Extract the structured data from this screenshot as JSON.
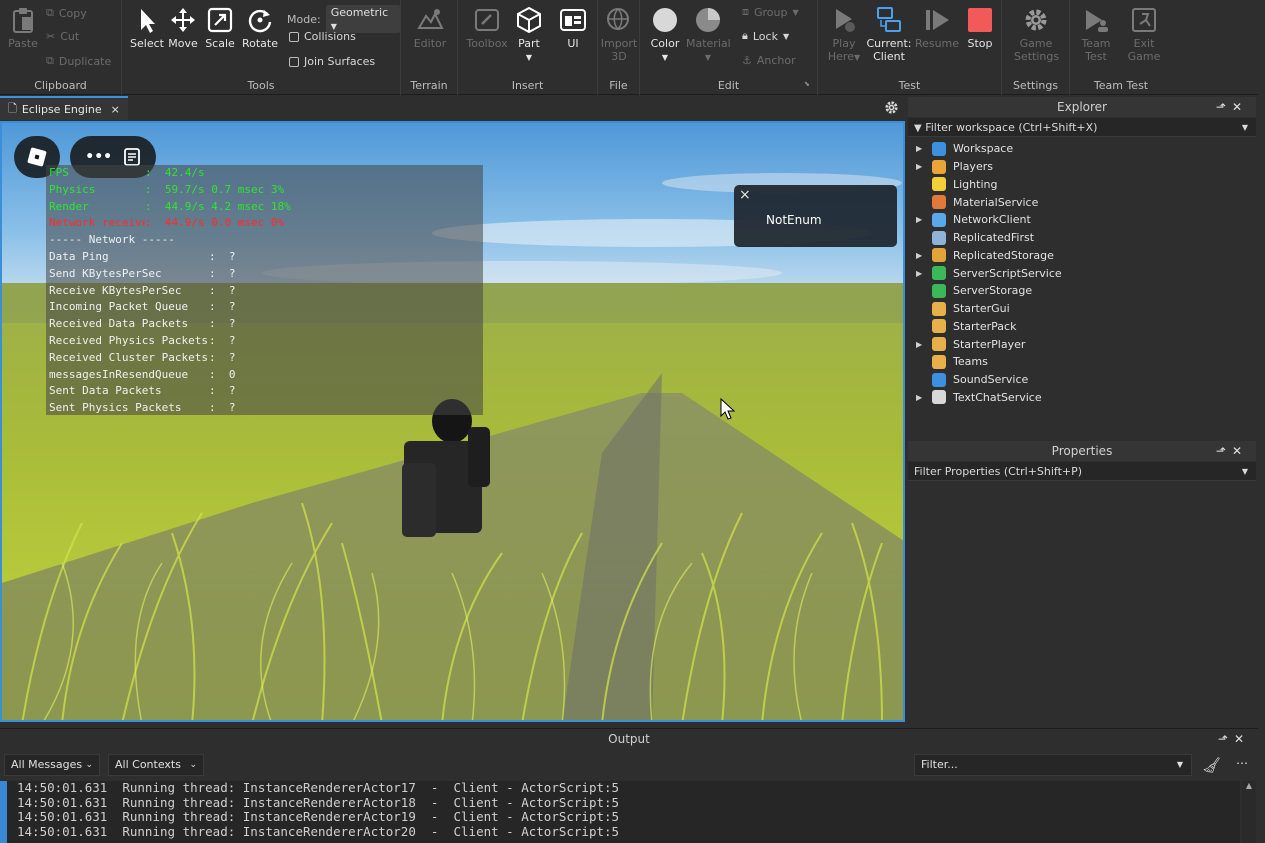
{
  "ribbon": {
    "clipboard": {
      "group_label": "Clipboard",
      "paste": "Paste",
      "copy": "Copy",
      "cut": "Cut",
      "duplicate": "Duplicate"
    },
    "tools": {
      "group_label": "Tools",
      "select": "Select",
      "move": "Move",
      "scale": "Scale",
      "rotate": "Rotate",
      "mode_label": "Mode:",
      "mode_value": "Geometric",
      "collisions": "Collisions",
      "join_surfaces": "Join Surfaces"
    },
    "terrain": {
      "group_label": "Terrain",
      "editor": "Editor"
    },
    "insert": {
      "group_label": "Insert",
      "toolbox": "Toolbox",
      "part": "Part",
      "ui": "UI"
    },
    "file": {
      "group_label": "File",
      "import": "Import",
      "import_sub": "3D"
    },
    "edit": {
      "group_label": "Edit",
      "color": "Color",
      "material": "Material",
      "group": "Group",
      "lock": "Lock",
      "anchor": "Anchor"
    },
    "test": {
      "group_label": "Test",
      "play": "Play",
      "play_sub": "Here",
      "current": "Current:",
      "current_sub": "Client",
      "resume": "Resume",
      "stop": "Stop"
    },
    "settings": {
      "group_label": "Settings",
      "game_settings": "Game",
      "game_settings_sub": "Settings"
    },
    "team_test": {
      "group_label": "Team Test",
      "team": "Team",
      "team_sub": "Test",
      "exit": "Exit",
      "exit_sub": "Game"
    }
  },
  "tab": {
    "label": "Eclipse Engine",
    "close": "×"
  },
  "stats": {
    "fps": {
      "key": "FPS",
      "val": ":  42.4/s"
    },
    "physics": {
      "key": "Physics",
      "val": ":  59.7/s 0.7 msec 3%"
    },
    "render": {
      "key": "Render",
      "val": ":  44.9/s 4.2 msec 18%"
    },
    "netrecv": {
      "key": "Network receive",
      "val": ":  44.9/s 0.0 msec 0%"
    },
    "network_header": "----- Network -----",
    "rows": [
      {
        "k": "Data Ping",
        "v": ":  ?"
      },
      {
        "k": "Send KBytesPerSec",
        "v": ":  ?"
      },
      {
        "k": "Receive KBytesPerSec",
        "v": ":  ?"
      },
      {
        "k": "Incoming Packet Queue",
        "v": ":  ?"
      },
      {
        "k": "Received Data Packets",
        "v": ":  ?"
      },
      {
        "k": "Received Physics Packets",
        "v": ":  ?"
      },
      {
        "k": "Received Cluster Packets",
        "v": ":  ?"
      },
      {
        "k": "messagesInResendQueue",
        "v": ":  0"
      },
      {
        "k": "Sent Data Packets",
        "v": ":  ?"
      },
      {
        "k": "Sent Physics Packets",
        "v": ":  ?"
      }
    ]
  },
  "notification": {
    "text": "NotEnum",
    "close": "×"
  },
  "explorer": {
    "title": "Explorer",
    "filter": "Filter workspace (Ctrl+Shift+X)",
    "items": [
      {
        "label": "Workspace",
        "expandable": true,
        "color": "#3d8fe0"
      },
      {
        "label": "Players",
        "expandable": true,
        "color": "#e8a53a"
      },
      {
        "label": "Lighting",
        "expandable": false,
        "color": "#f3d03a"
      },
      {
        "label": "MaterialService",
        "expandable": false,
        "color": "#e07a3a"
      },
      {
        "label": "NetworkClient",
        "expandable": true,
        "color": "#5aa8e8"
      },
      {
        "label": "ReplicatedFirst",
        "expandable": false,
        "color": "#8fb3d8"
      },
      {
        "label": "ReplicatedStorage",
        "expandable": true,
        "color": "#e0a43a"
      },
      {
        "label": "ServerScriptService",
        "expandable": true,
        "color": "#3cb85a"
      },
      {
        "label": "ServerStorage",
        "expandable": false,
        "color": "#3cb85a"
      },
      {
        "label": "StarterGui",
        "expandable": false,
        "color": "#e8b04a"
      },
      {
        "label": "StarterPack",
        "expandable": false,
        "color": "#e8b04a"
      },
      {
        "label": "StarterPlayer",
        "expandable": true,
        "color": "#e8b04a"
      },
      {
        "label": "Teams",
        "expandable": false,
        "color": "#e8b04a"
      },
      {
        "label": "SoundService",
        "expandable": false,
        "color": "#3d8fe0"
      },
      {
        "label": "TextChatService",
        "expandable": true,
        "color": "#d8d8d8"
      }
    ]
  },
  "properties": {
    "title": "Properties",
    "filter": "Filter Properties (Ctrl+Shift+P)"
  },
  "output": {
    "title": "Output",
    "messages_filter": "All Messages",
    "contexts_filter": "All Contexts",
    "filter_placeholder": "Filter...",
    "lines": [
      "14:50:01.631  Running thread: InstanceRendererActor17  -  Client - ActorScript:5",
      "14:50:01.631  Running thread: InstanceRendererActor18  -  Client - ActorScript:5",
      "14:50:01.631  Running thread: InstanceRendererActor19  -  Client - ActorScript:5",
      "14:50:01.631  Running thread: InstanceRendererActor20  -  Client - ActorScript:5"
    ]
  }
}
